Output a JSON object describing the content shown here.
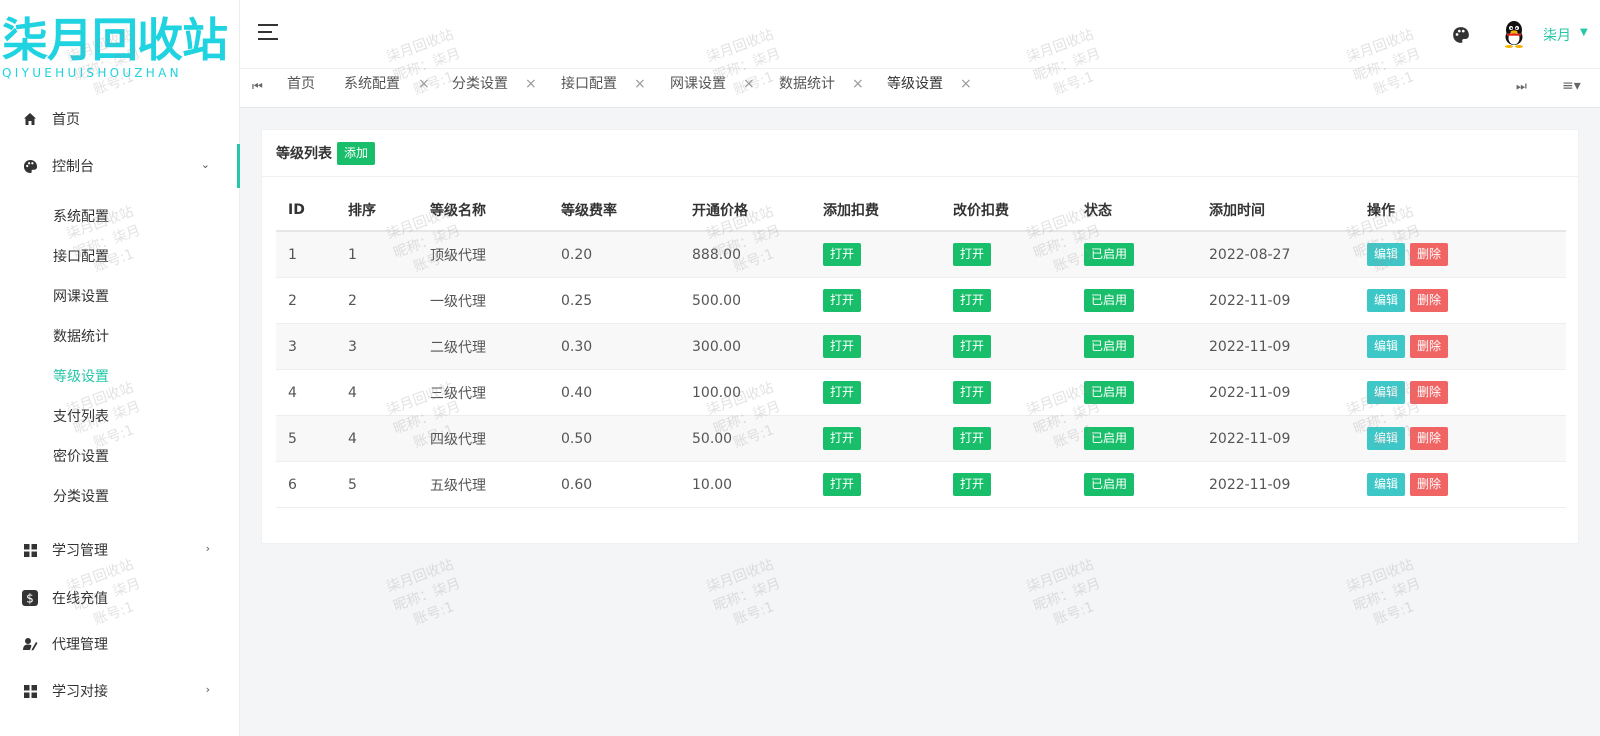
{
  "logo": {
    "main": "柒月回收站",
    "sub": "QIYUEHUISHOUZHAN"
  },
  "sidebar": {
    "items": [
      {
        "label": "首页",
        "icon": "home-icon"
      },
      {
        "label": "控制台",
        "icon": "palette-icon"
      },
      {
        "label": "学习管理",
        "icon": "grid-icon"
      },
      {
        "label": "在线充值",
        "icon": "dollar-icon"
      },
      {
        "label": "代理管理",
        "icon": "user-edit-icon"
      },
      {
        "label": "学习对接",
        "icon": "grid-icon"
      }
    ],
    "subitems": [
      "系统配置",
      "接口配置",
      "网课设置",
      "数据统计",
      "等级设置",
      "支付列表",
      "密价设置",
      "分类设置"
    ]
  },
  "header": {
    "user_name": "柒月"
  },
  "tabs": [
    {
      "label": "首页"
    },
    {
      "label": "系统配置"
    },
    {
      "label": "分类设置"
    },
    {
      "label": "接口配置"
    },
    {
      "label": "网课设置"
    },
    {
      "label": "数据统计"
    },
    {
      "label": "等级设置"
    }
  ],
  "tab_close": "×",
  "card": {
    "title": "等级列表",
    "add_label": "添加"
  },
  "table": {
    "headers": [
      "ID",
      "排序",
      "等级名称",
      "等级费率",
      "开通价格",
      "添加扣费",
      "改价扣费",
      "状态",
      "添加时间",
      "操作"
    ],
    "rows": [
      [
        "1",
        "1",
        "顶级代理",
        "0.20",
        "888.00",
        "打开",
        "打开",
        "已启用",
        "2022-08-27"
      ],
      [
        "2",
        "2",
        "一级代理",
        "0.25",
        "500.00",
        "打开",
        "打开",
        "已启用",
        "2022-11-09"
      ],
      [
        "3",
        "3",
        "二级代理",
        "0.30",
        "300.00",
        "打开",
        "打开",
        "已启用",
        "2022-11-09"
      ],
      [
        "4",
        "4",
        "三级代理",
        "0.40",
        "100.00",
        "打开",
        "打开",
        "已启用",
        "2022-11-09"
      ],
      [
        "5",
        "4",
        "四级代理",
        "0.50",
        "50.00",
        "打开",
        "打开",
        "已启用",
        "2022-11-09"
      ],
      [
        "6",
        "5",
        "五级代理",
        "0.60",
        "10.00",
        "打开",
        "打开",
        "已启用",
        "2022-11-09"
      ]
    ],
    "edit_label": "编辑",
    "delete_label": "删除"
  },
  "watermark": {
    "line1": "柒月回收站",
    "line2": "昵称：柒月",
    "line3": "账号:1"
  },
  "colors": {
    "accent": "#26c6a8",
    "logo": "#1fd3e0",
    "green": "#19be6b",
    "teal": "#3ec7c7",
    "red": "#f06464"
  }
}
